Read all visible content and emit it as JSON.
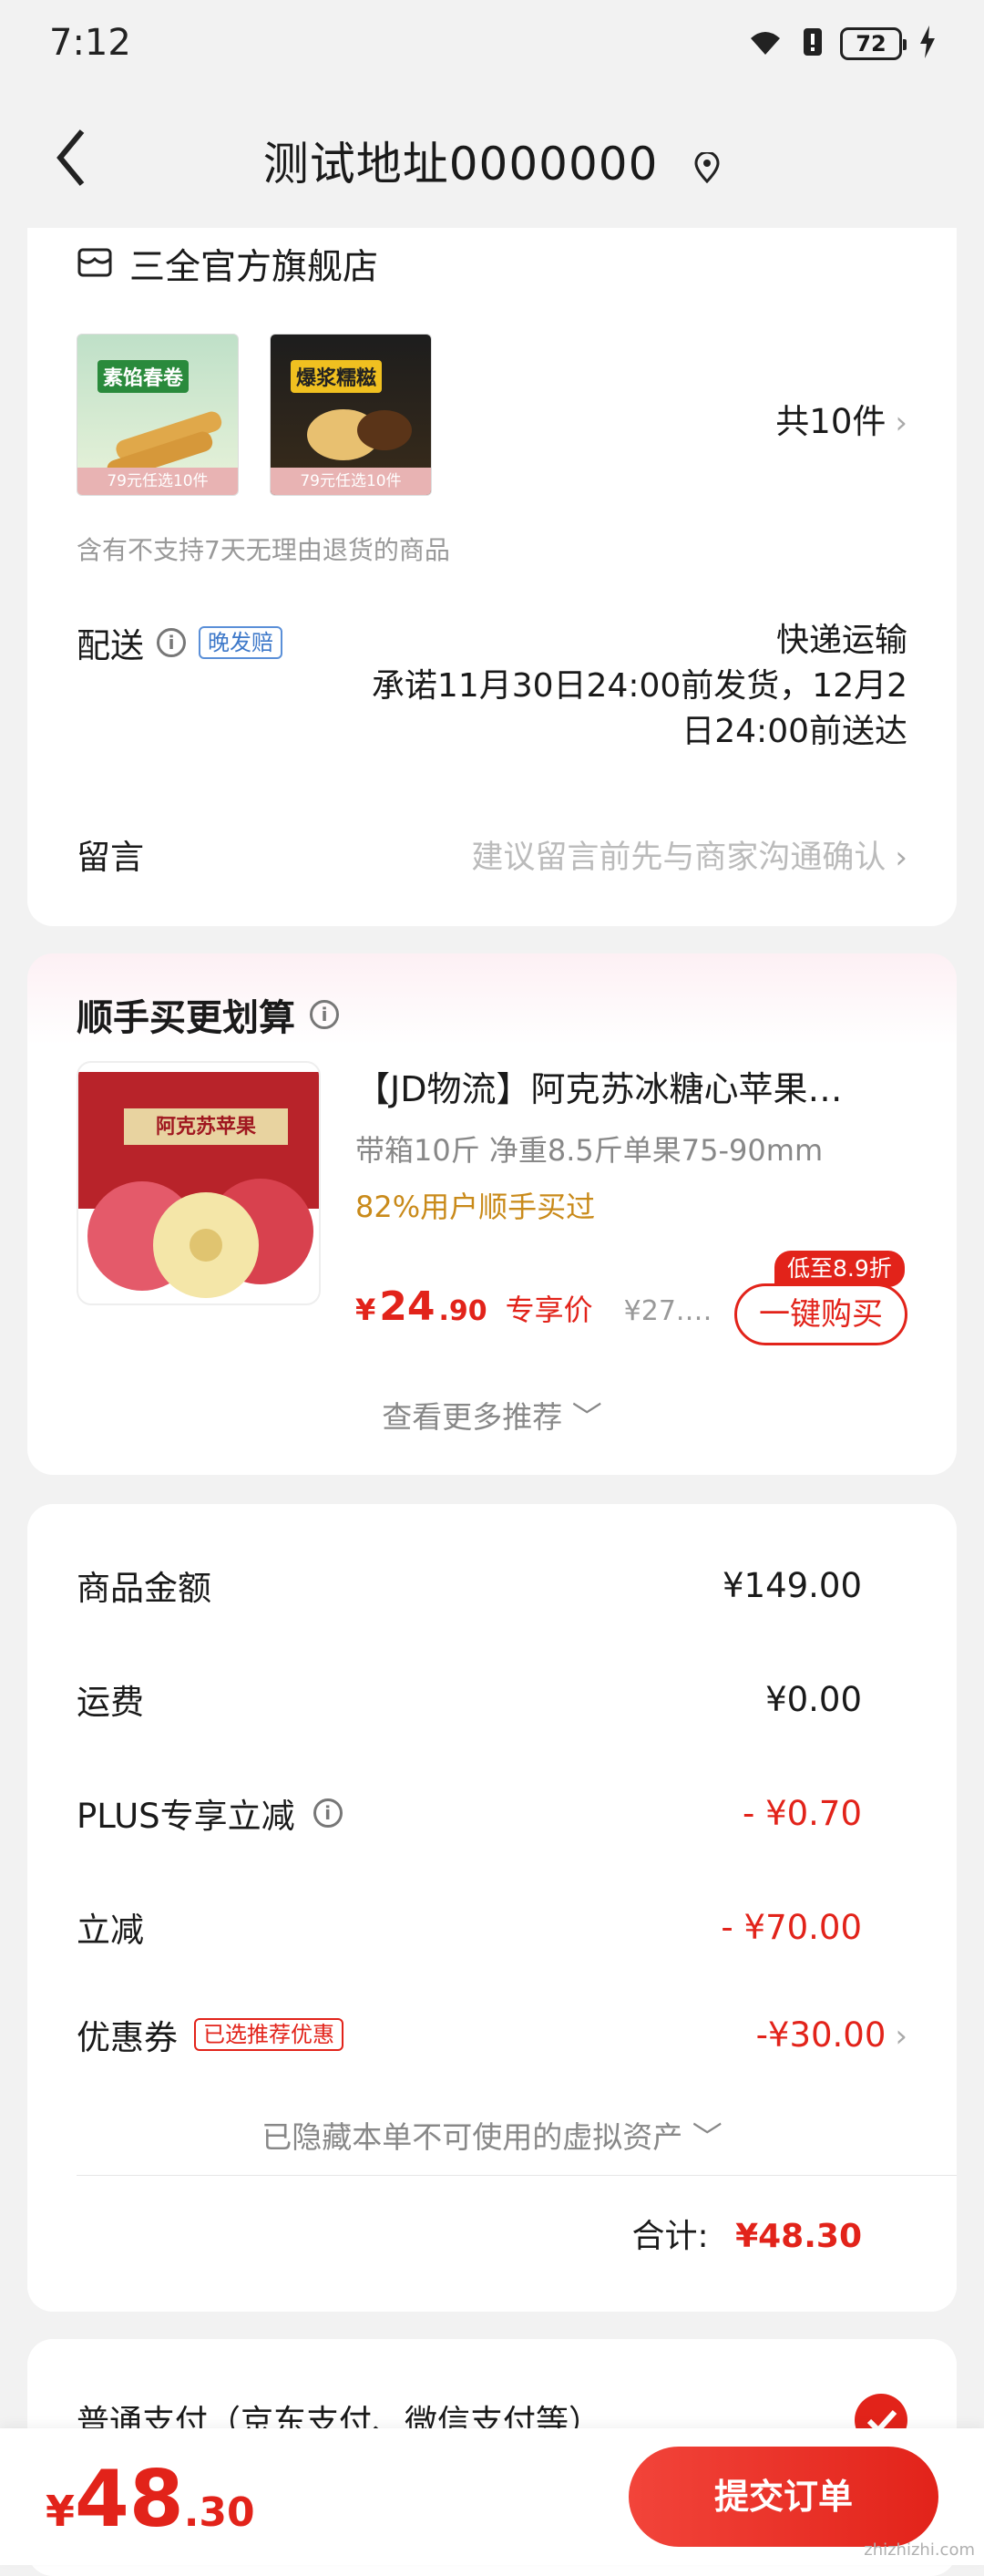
{
  "status": {
    "time": "7:12",
    "battery": "72"
  },
  "header": {
    "title": "测试地址0000000"
  },
  "store": {
    "name": "三全官方旗舰店",
    "items": [
      {
        "name": "素馅春卷",
        "tag": "79元任选10件",
        "days": "7"
      },
      {
        "name": "爆浆糯糍",
        "tag": "79元任选10件",
        "days": "7"
      }
    ],
    "count_label": "共10件",
    "return_notice": "含有不支持7天无理由退货的商品",
    "delivery_label": "配送",
    "delivery_badge": "晚发赔",
    "delivery_method": "快递运输",
    "delivery_promise_1": "承诺11月30日24:00前发货，12月2",
    "delivery_promise_2": "日24:00前送达",
    "message_label": "留言",
    "message_placeholder": "建议留言前先与商家沟通确认"
  },
  "recommend": {
    "title": "顺手买更划算",
    "product_title": "【JD物流】阿克苏冰糖心苹果…",
    "product_spec": "带箱10斤 净重8.5斤单果75-90mm",
    "buy_rate": "82%用户顺手买过",
    "price_yen": "¥",
    "price_int": "24",
    "price_dec": ".90",
    "price_label": "专享价",
    "orig_price": "¥27.…",
    "discount_badge": "低至8.9折",
    "buy_button": "一键购买",
    "box_text": "阿克苏苹果",
    "more": "查看更多推荐"
  },
  "summary": {
    "rows": [
      {
        "label": "商品金额",
        "value": "¥149.00"
      },
      {
        "label": "运费",
        "value": "¥0.00"
      },
      {
        "label": "PLUS专享立减",
        "value": "- ¥0.70"
      },
      {
        "label": "立减",
        "value": "- ¥70.00"
      },
      {
        "label": "优惠券",
        "value": "-¥30.00",
        "badge": "已选推荐优惠"
      }
    ],
    "hidden_assets": "已隐藏本单不可使用的虚拟资产",
    "total_label": "合计:",
    "total_value": "¥48.30"
  },
  "payment": {
    "method": "普通支付（京东支付、微信支付等）"
  },
  "bottom": {
    "yen": "¥",
    "int": "48",
    "dec": ".30",
    "submit": "提交订单",
    "watermark": "zhizhizhi.com"
  },
  "colors": {
    "accent": "#e2231a",
    "background": "#f2f2f2"
  }
}
